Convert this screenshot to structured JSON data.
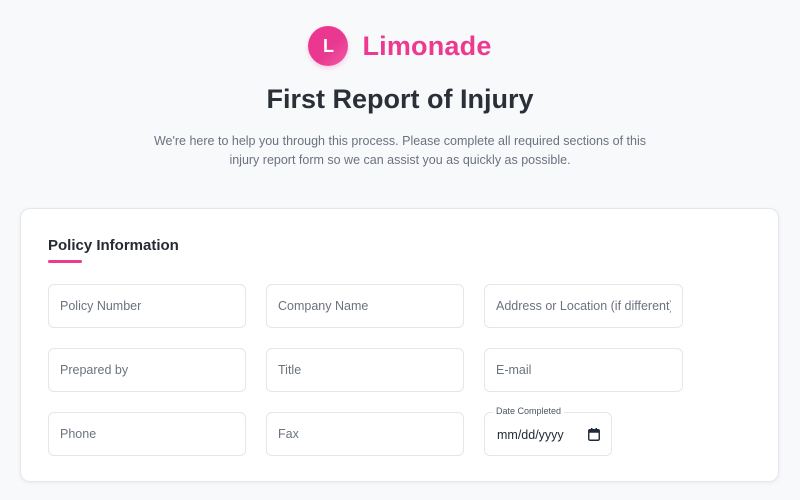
{
  "brand": {
    "logo_letter": "L",
    "name": "Limonade",
    "accent_color": "#ec3a91"
  },
  "page": {
    "title": "First Report of Injury",
    "intro": "We're here to help you through this process. Please complete all required sections of this injury report form so we can assist you as quickly as possible."
  },
  "section": {
    "title": "Policy Information"
  },
  "fields": {
    "policy_number": {
      "placeholder": "Policy Number",
      "value": ""
    },
    "company_name": {
      "placeholder": "Company Name",
      "value": ""
    },
    "address": {
      "placeholder": "Address or Location (if different)",
      "value": ""
    },
    "prepared_by": {
      "placeholder": "Prepared by",
      "value": ""
    },
    "title": {
      "placeholder": "Title",
      "value": ""
    },
    "email": {
      "placeholder": "E-mail",
      "value": ""
    },
    "phone": {
      "placeholder": "Phone",
      "value": ""
    },
    "fax": {
      "placeholder": "Fax",
      "value": ""
    },
    "date_completed": {
      "label": "Date Completed",
      "value": "mm/dd/yyyy",
      "icon": "calendar-icon"
    }
  }
}
